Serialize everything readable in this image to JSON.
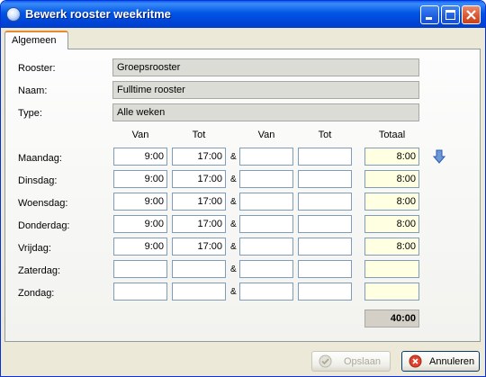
{
  "window": {
    "title": "Bewerk rooster weekritme"
  },
  "tabs": [
    {
      "label": "Algemeen"
    }
  ],
  "info": {
    "rooster_label": "Rooster:",
    "rooster_value": "Groepsrooster",
    "naam_label": "Naam:",
    "naam_value": "Fulltime rooster",
    "type_label": "Type:",
    "type_value": "Alle weken"
  },
  "headers": {
    "van1": "Van",
    "tot1": "Tot",
    "van2": "Van",
    "tot2": "Tot",
    "totaal": "Totaal"
  },
  "ampersand": "&",
  "days": [
    {
      "label": "Maandag:",
      "van1": "9:00",
      "tot1": "17:00",
      "van2": "",
      "tot2": "",
      "totaal": "8:00"
    },
    {
      "label": "Dinsdag:",
      "van1": "9:00",
      "tot1": "17:00",
      "van2": "",
      "tot2": "",
      "totaal": "8:00"
    },
    {
      "label": "Woensdag:",
      "van1": "9:00",
      "tot1": "17:00",
      "van2": "",
      "tot2": "",
      "totaal": "8:00"
    },
    {
      "label": "Donderdag:",
      "van1": "9:00",
      "tot1": "17:00",
      "van2": "",
      "tot2": "",
      "totaal": "8:00"
    },
    {
      "label": "Vrijdag:",
      "van1": "9:00",
      "tot1": "17:00",
      "van2": "",
      "tot2": "",
      "totaal": "8:00"
    },
    {
      "label": "Zaterdag:",
      "van1": "",
      "tot1": "",
      "van2": "",
      "tot2": "",
      "totaal": ""
    },
    {
      "label": "Zondag:",
      "van1": "",
      "tot1": "",
      "van2": "",
      "tot2": "",
      "totaal": ""
    }
  ],
  "grand_total": "40:00",
  "buttons": {
    "save": "Opslaan",
    "cancel": "Annuleren"
  },
  "icons": {
    "app": "window-icon",
    "minimize": "minimize-icon",
    "maximize": "maximize-icon",
    "close": "close-icon",
    "copy_down": "arrow-down-icon",
    "save": "checkmark-icon",
    "cancel": "cancel-icon"
  },
  "colors": {
    "titlebar": "#0054e3",
    "total_bg": "#ffffe1",
    "readonly_bg": "#dcdcd7",
    "close": "#d9552f"
  }
}
